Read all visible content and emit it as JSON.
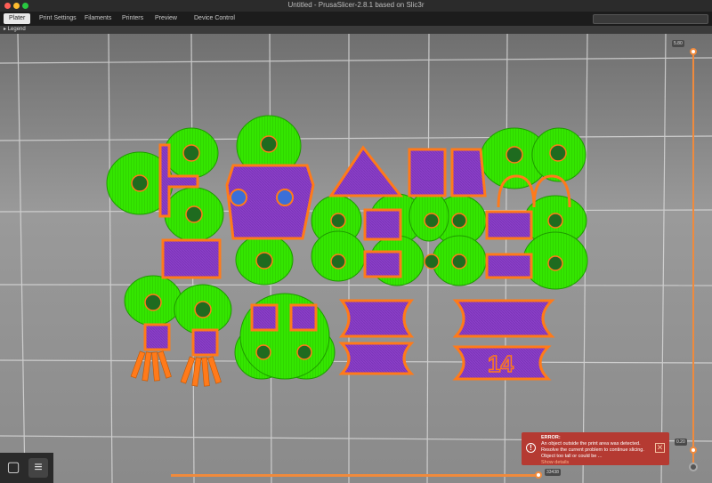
{
  "window": {
    "title": "Untitled - PrusaSlicer-2.8.1 based on Slic3r"
  },
  "tabs": [
    {
      "label": "Plater",
      "active": true
    },
    {
      "label": "Print Settings",
      "active": false
    },
    {
      "label": "Filaments",
      "active": false
    },
    {
      "label": "Printers",
      "active": false
    },
    {
      "label": "Preview",
      "active": false
    },
    {
      "label": "Device Control",
      "active": false
    }
  ],
  "legend": {
    "label": "Legend"
  },
  "slider": {
    "top_value": "5.80",
    "bottom_value": "0.20",
    "h_value": "33438"
  },
  "error": {
    "title": "ERROR:",
    "line1": "An object outside the print area was detected.",
    "line2": "Resolve the current problem to continue slicing.",
    "line3": "Object too tall or could be ...",
    "link": "Show details"
  },
  "model": {
    "label": "14"
  },
  "colors": {
    "infill": "#34e600",
    "perimeter": "#ff7a1a",
    "solid": "#8a3fc8",
    "bed": "#8e8e8e",
    "accent": "#f08a3c",
    "error": "#b53a32"
  }
}
